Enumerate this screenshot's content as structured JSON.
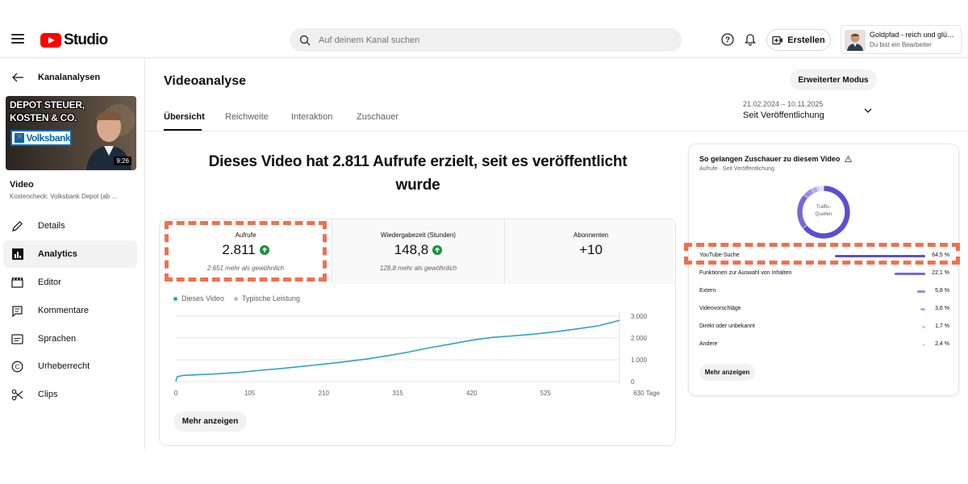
{
  "app": {
    "logo_text": "Studio"
  },
  "search": {
    "placeholder": "Auf deinem Kanal suchen"
  },
  "header": {
    "create_label": "Erstellen"
  },
  "account": {
    "name": "Goldpfad - reich und glü…",
    "role": "Du bist ein Bearbeiter"
  },
  "sidebar": {
    "section_title": "Kanalanalysen",
    "thumbnail": {
      "line1": "DEPOT STEUER,",
      "line2": "KOSTEN & CO.",
      "brand": "Volksbank",
      "duration": "9:26"
    },
    "video_label": "Video",
    "video_title": "Kostencheck: Volksbank Depot (ab …",
    "items": [
      {
        "label": "Details",
        "icon": "pencil-icon"
      },
      {
        "label": "Analytics",
        "icon": "analytics-icon"
      },
      {
        "label": "Editor",
        "icon": "clapperboard-icon"
      },
      {
        "label": "Kommentare",
        "icon": "comment-icon"
      },
      {
        "label": "Sprachen",
        "icon": "subtitles-icon"
      },
      {
        "label": "Urheberrecht",
        "icon": "copyright-icon"
      },
      {
        "label": "Clips",
        "icon": "scissors-icon"
      }
    ],
    "active_item": "Analytics"
  },
  "main": {
    "page_title": "Videoanalyse",
    "advanced_button": "Erweiterter Modus",
    "tabs": [
      {
        "label": "Übersicht"
      },
      {
        "label": "Reichweite"
      },
      {
        "label": "Interaktion"
      },
      {
        "label": "Zuschauer"
      }
    ],
    "date_range": "21.02.2024 – 10.11.2025",
    "date_label": "Seit Veröffentlichung",
    "headline": "Dieses Video hat 2.811 Aufrufe erzielt, seit es veröffentlicht wurde"
  },
  "metrics": [
    {
      "label": "Aufrufe",
      "value": "2.811",
      "sub": "2.651 mehr als gewöhnlich",
      "trend": "up"
    },
    {
      "label": "Wiedergabezeit (Stunden)",
      "value": "148,8",
      "sub": "128,8 mehr als gewöhnlich",
      "trend": "up"
    },
    {
      "label": "Abonnenten",
      "value": "+10",
      "sub": ""
    }
  ],
  "chart": {
    "legend": [
      "Dieses Video",
      "Typische Leistung"
    ],
    "more_button": "Mehr anzeigen"
  },
  "chart_data": {
    "type": "line",
    "x_tick_labels": [
      "0",
      "105",
      "210",
      "315",
      "420",
      "525",
      "630 Tage"
    ],
    "y_tick_labels": [
      "3.000",
      "2.000",
      "1.000",
      "0"
    ],
    "x_ticks": [
      0,
      105,
      210,
      315,
      420,
      525,
      630
    ],
    "y_ticks": [
      0,
      1000,
      2000,
      3000
    ],
    "xlim": [
      0,
      630
    ],
    "ylim": [
      0,
      3000
    ],
    "series": [
      {
        "name": "Dieses Video",
        "color": "#2ea3c5",
        "x": [
          0,
          1,
          2,
          10,
          30,
          60,
          90,
          120,
          150,
          180,
          210,
          240,
          270,
          300,
          330,
          360,
          390,
          420,
          450,
          480,
          510,
          540,
          570,
          600,
          630
        ],
        "y": [
          0,
          150,
          220,
          280,
          310,
          360,
          420,
          520,
          600,
          700,
          800,
          910,
          1030,
          1180,
          1350,
          1550,
          1720,
          1900,
          2030,
          2100,
          2180,
          2290,
          2420,
          2560,
          2811
        ]
      },
      {
        "name": "Typische Leistung",
        "color": "#bdbdbd",
        "x": [],
        "y": []
      }
    ],
    "grid": true,
    "legend_position": "top-left",
    "accent_color": "#2ea3c5"
  },
  "traffic": {
    "title": "So gelangen Zuschauer zu diesem Video",
    "subtitle": "Aufrufe · Seit Veröffentlichung",
    "donut_label_1": "Traffic-",
    "donut_label_2": "Quellen",
    "sources": [
      {
        "name": "YouTube-Suche",
        "value": "64,5 %",
        "pct": 64.5,
        "color": "#5c4fd0"
      },
      {
        "name": "Funktionen zur Auswahl von Inhalten",
        "value": "22,1 %",
        "pct": 22.1,
        "color": "#7868d8"
      },
      {
        "name": "Extern",
        "value": "5,8 %",
        "pct": 5.8,
        "color": "#9a8ee3"
      },
      {
        "name": "Videovorschläge",
        "value": "3,6 %",
        "pct": 3.6,
        "color": "#b3aaeb"
      },
      {
        "name": "Direkt oder unbekannt",
        "value": "1,7 %",
        "pct": 1.7,
        "color": "#cdc8f2"
      },
      {
        "name": "Andere",
        "value": "2,4 %",
        "pct": 2.4,
        "color": "#e2dff8"
      }
    ],
    "more_button": "Mehr anzeigen"
  },
  "colors": {
    "accent": "#ff0000",
    "highlight": "#f26f4e",
    "trend_up": "#1e8e3e"
  }
}
